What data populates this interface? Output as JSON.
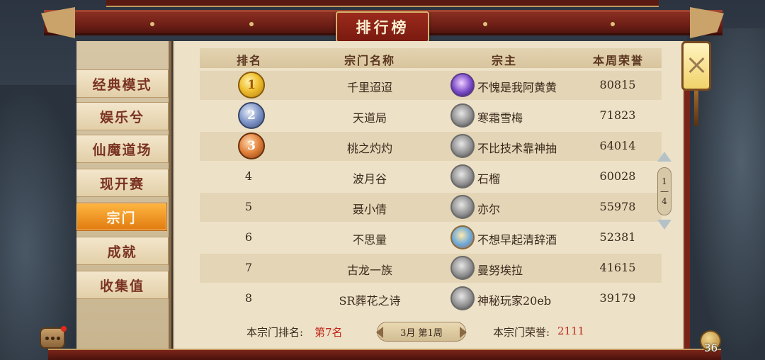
{
  "title": "排行榜",
  "sidebar": {
    "tabs": [
      {
        "label": "经典模式",
        "active": false
      },
      {
        "label": "娱乐兮",
        "active": false
      },
      {
        "label": "仙魔道场",
        "active": false
      },
      {
        "label": "现开赛",
        "active": false
      },
      {
        "label": "宗门",
        "active": true
      },
      {
        "label": "成就",
        "active": false
      },
      {
        "label": "收集值",
        "active": false
      }
    ]
  },
  "table": {
    "headers": {
      "rank": "排名",
      "sect": "宗门名称",
      "leader": "宗主",
      "honor": "本周荣誉"
    },
    "rows": [
      {
        "rank": "1",
        "sect": "千里迢迢",
        "leader": "不愧是我阿黄黄",
        "honor": "80815",
        "medal": "gold",
        "avatar": "purple-avatar"
      },
      {
        "rank": "2",
        "sect": "天道局",
        "leader": "寒霜雪梅",
        "honor": "71823",
        "medal": "silver",
        "avatar": "grey-avatar"
      },
      {
        "rank": "3",
        "sect": "桃之灼灼",
        "leader": "不比技术靠神抽",
        "honor": "64014",
        "medal": "bronze",
        "avatar": "grey-avatar"
      },
      {
        "rank": "4",
        "sect": "波月谷",
        "leader": "石榴",
        "honor": "60028",
        "medal": "",
        "avatar": "grey-avatar"
      },
      {
        "rank": "5",
        "sect": "聂小倩",
        "leader": "亦尔",
        "honor": "55978",
        "medal": "",
        "avatar": "grey-avatar"
      },
      {
        "rank": "6",
        "sect": "不思量",
        "leader": "不想早起清辞酒",
        "honor": "52381",
        "medal": "",
        "avatar": "color-avatar"
      },
      {
        "rank": "7",
        "sect": "古龙一族",
        "leader": "曼努埃拉",
        "honor": "41615",
        "medal": "",
        "avatar": "grey-avatar"
      },
      {
        "rank": "8",
        "sect": "SR葬花之诗",
        "leader": "神秘玩家20eb",
        "honor": "39179",
        "medal": "",
        "avatar": "grey-avatar"
      }
    ]
  },
  "footer": {
    "my_rank_label": "本宗门排名:",
    "my_rank_value": "第7名",
    "week": "3月 第1周",
    "my_honor_label": "本宗门荣誉:",
    "my_honor_value": "2111"
  },
  "pager": {
    "current": "1",
    "total": "4"
  },
  "hud": {
    "gourd_count": "36"
  },
  "colors": {
    "accent_red": "#c0281a",
    "active_tab": "#f09a20",
    "beam": "#7a2419"
  }
}
